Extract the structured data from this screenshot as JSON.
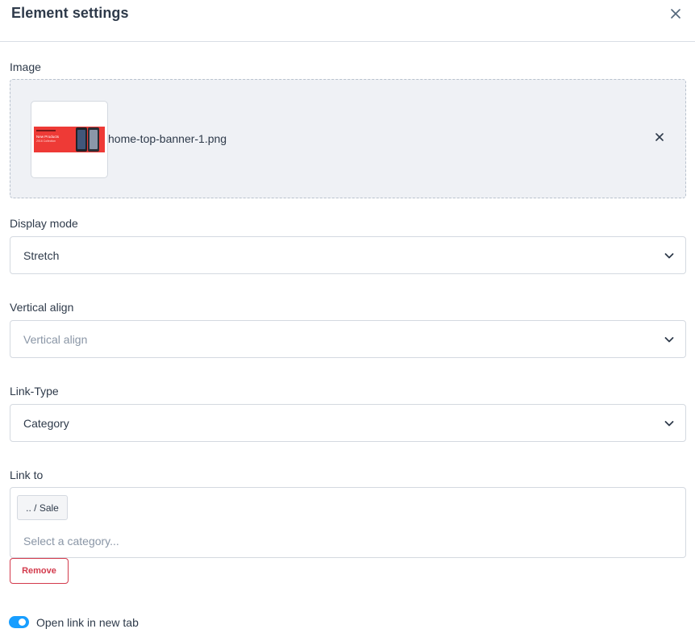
{
  "modal": {
    "title": "Element settings",
    "close_icon": "close-icon"
  },
  "image": {
    "label": "Image",
    "file_name": "home-top-banner-1.png",
    "thumbnail_text": [
      "New Products",
      "2016 Collection"
    ],
    "remove_icon": "close-icon",
    "banner_color": "#ee3a36"
  },
  "display_mode": {
    "label": "Display mode",
    "value": "Stretch"
  },
  "vertical_align": {
    "label": "Vertical align",
    "value": "",
    "placeholder": "Vertical align"
  },
  "link_type": {
    "label": "Link-Type",
    "value": "Category"
  },
  "link_to": {
    "label": "Link to",
    "selected_chip": ".. / Sale",
    "placeholder": "Select a category..."
  },
  "remove_button": {
    "label": "Remove",
    "color": "#d33a4c"
  },
  "new_tab": {
    "label": "Open link in new tab",
    "enabled": true,
    "accent": "#189eff"
  }
}
